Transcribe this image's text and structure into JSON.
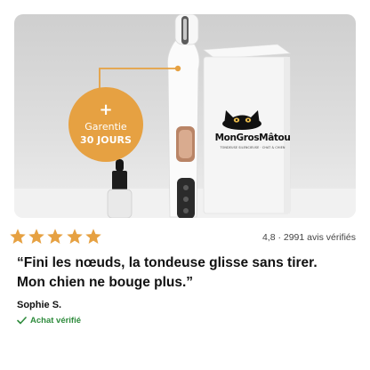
{
  "colors": {
    "star": "#e6a142",
    "badge": "#e6a142",
    "verified": "#2e8b3c"
  },
  "product_image": {
    "badge": {
      "plus": "+",
      "line1": "Garentie",
      "line2": "30 JOURS"
    },
    "box_brand": "MonGrosMâtou",
    "box_tagline": "TONDEUSE SILENCIEUSE · CHAT & CHIEN"
  },
  "rating": {
    "stars_filled": 5,
    "stars_total": 5,
    "summary": "4,8 · 2991 avis vérifiés"
  },
  "review": {
    "quote": "“Fini les nœuds, la tondeuse glisse sans tirer. Mon chien ne bouge plus.”",
    "author": "Sophie S.",
    "verified_label": "Achat vérifié",
    "verified_icon": "checkmark-icon"
  }
}
